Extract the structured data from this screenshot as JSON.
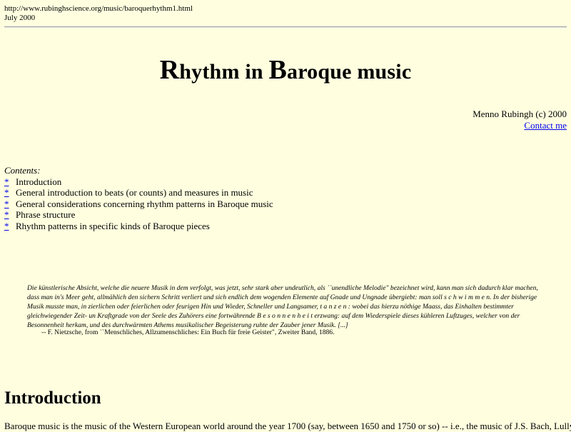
{
  "header": {
    "url": "http://www.rubinghscience.org/music/baroquerhythm1.html",
    "date": "July 2000"
  },
  "title": {
    "r_cap": "R",
    "r_rest": "hythm in ",
    "b_cap": "B",
    "b_rest": "aroque music"
  },
  "author": {
    "credit": "Menno Rubingh (c) 2000",
    "contact_link": "Contact me"
  },
  "contents": {
    "heading": "Contents:",
    "marker": "*",
    "items": [
      "Introduction",
      "General introduction to beats (or counts) and measures in music",
      "General considerations concerning rhythm patterns in Baroque music",
      "Phrase structure",
      "Rhythm patterns in specific kinds of Baroque pieces"
    ]
  },
  "quote": {
    "text": "Die künstlerische Absicht, welche die neuere Musik in dem verfolgt, was jetzt, sehr stark aber undeutlich, als ``unendliche Melodie\" bezeichnet wird, kann man sich dadurch klar machen, dass man in's Meer geht, allmählich den sichern Schritt verliert und sich endlich dem wogenden Elemente auf Gnade und Ungnade übergiebt: man soll s c h w i m m e n.  In der bisherige Musik musste man, in zierlichen oder feierlichen oder feurigen Hin und Wieder, Schneller und Langsamer, t a n z e n : wobei das hierzu nöthige Maass, das Einhalten bestimmter gleichwiegender Zeit- un Kraftgrade von der Seele des Zuhörers eine fortwährende B e s o n n e n h e i t  erzwang: auf dem Wiederspiele dieses kühleren Luftzuges, welcher von der Besonnenheit herkam, und des durchwärmten Athems musikalischer Begeisterung ruhte der Zauber jener Musik. [...]",
    "attribution": "-- F. Nietzsche, from ``Menschliches, Allzumenschliches: Ein Buch für freie Geister\", Zweiter Band, 1886."
  },
  "intro": {
    "heading": "Introduction",
    "text": "Baroque music is the music of the Western European world around the year 1700 (say, between 1650 and 1750 or so) -- i.e., the music of J.S. Bach, Lully,"
  }
}
